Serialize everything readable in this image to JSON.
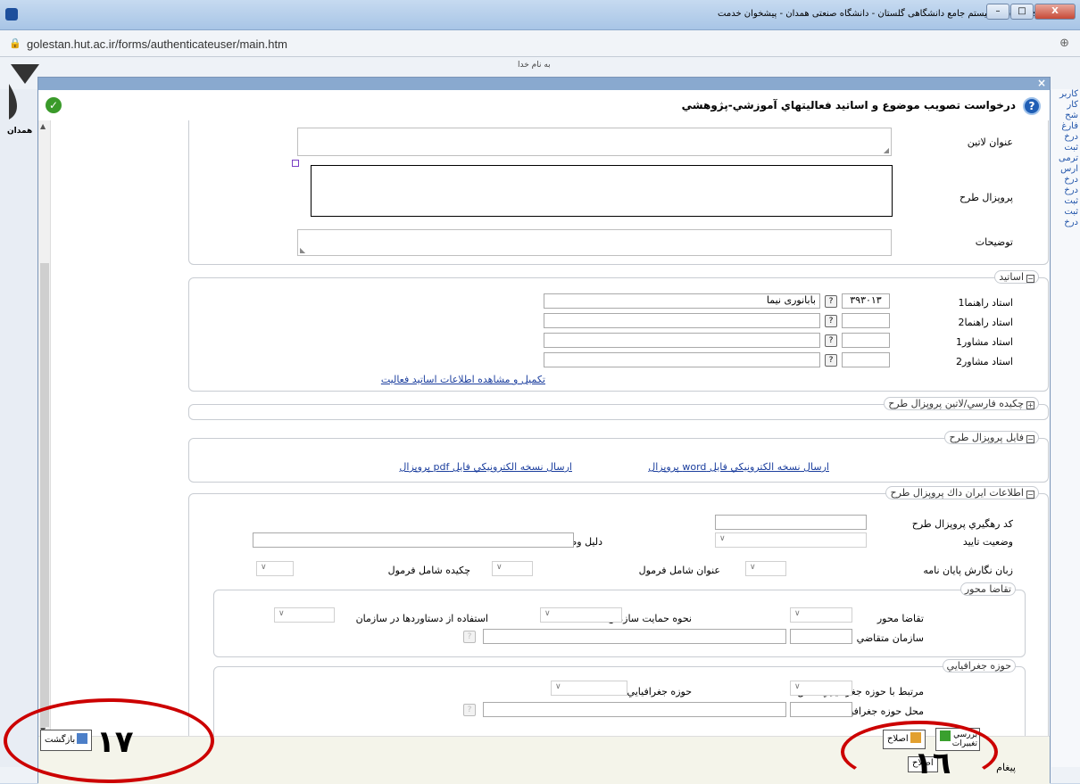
{
  "window": {
    "title": "Google Chrome - سیستم جامع دانشگاهی گلستان - دانشگاه صنعتی همدان - پیشخوان خدمت",
    "minimize": "–",
    "maximize": "□",
    "close": "X"
  },
  "address_bar": {
    "url": "golestan.hut.ac.ir/forms/authenticateuser/main.htm"
  },
  "background_page": {
    "header_text": "به نام خدا",
    "logo_text": "همدان",
    "right_links": [
      "کاربر",
      "کار",
      "شح",
      "فارغ",
      "درخ",
      "ثبت",
      "ترمی",
      "ارس",
      "درخ",
      "درخ",
      "ثبت",
      "ثبت",
      "درخ"
    ]
  },
  "dialog": {
    "title": "درخواست تصويب موضوع و اساتيد فعاليتهاي آموزشي-پژوهشي",
    "close": "×",
    "help": "?",
    "ok": "✓"
  },
  "form": {
    "latin_title_label": "عنوان لاتين",
    "proposal_label": "پروپزال طرح",
    "description_label": "توضيحات",
    "professors": {
      "legend": "اساتيد",
      "rows": [
        {
          "label": "استاد راهنما1",
          "code": "۳۹۳۰۱۳",
          "name": "بابانوری نیما"
        },
        {
          "label": "استاد راهنما2",
          "code": "",
          "name": ""
        },
        {
          "label": "استاد مشاور1",
          "code": "",
          "name": ""
        },
        {
          "label": "استاد مشاور2",
          "code": "",
          "name": ""
        }
      ],
      "complete_link": "تكميل و مشاهده اطلاعات اساتيد فعاليت"
    },
    "abstract_legend": "چكيده فارسي/لاتين پروپزال طرح",
    "proposal_file": {
      "legend": "فايل پروپزال طرح",
      "word_link": "ارسال نسخه الكترونيكي فايل word پروپزال",
      "pdf_link": "ارسال نسخه الكترونيكي فايل pdf پروپزال"
    },
    "irandoc": {
      "legend": "اطلاعات ايران داك پروپزال طرح",
      "tracking_code_label": "كد رهگيري پروپزال طرح",
      "approval_status_label": "وضعيت تاييد",
      "approval_reason_label": "دليل وضعيت تاييد",
      "thesis_lang_label": "زبان نگارش پايان نامه",
      "title_formula_label": "عنوان شامل فرمول",
      "abstract_formula_label": "چكيده شامل فرمول"
    },
    "demand": {
      "legend": "تقاضا محور",
      "demand_label": "تقاضا محور",
      "support_label": "نحوه حمايت سازمان",
      "usage_label": "استفاده از دستاوردها در سازمان",
      "applicant_org_label": "سازمان متقاضي"
    },
    "geo": {
      "legend": "حوزه جغرافيايي",
      "related_label": "مرتبط با حوزه جغرافيايي خاص",
      "geo_area_label": "حوزه جغرافيايي",
      "geo_place_label": "محل حوزه جغرافيايي"
    }
  },
  "toolbar": {
    "back_button": "بازگشت",
    "review_button": "بررسي تغييرات",
    "fix_button": "اصلاح",
    "message_label": "پيغام",
    "message_fix_button": "اصلاح"
  },
  "annotations": {
    "left_number": "۱۷",
    "right_number": "۱٦"
  }
}
